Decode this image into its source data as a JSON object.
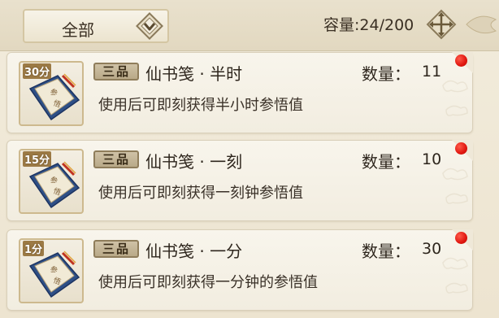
{
  "header": {
    "filter_label": "全部",
    "capacity_label": "容量:",
    "capacity_value": "24/200"
  },
  "items": [
    {
      "thumb_tag": "30分",
      "rank": "三品",
      "name": "仙书笺 · 半时",
      "qty_label": "数量：",
      "qty": "11",
      "desc": "使用后可即刻获得半小时参悟值"
    },
    {
      "thumb_tag": "15分",
      "rank": "三品",
      "name": "仙书笺 · 一刻",
      "qty_label": "数量：",
      "qty": "10",
      "desc": "使用后可即刻获得一刻钟参悟值"
    },
    {
      "thumb_tag": "1分",
      "rank": "三品",
      "name": "仙书笺 · 一分",
      "qty_label": "数量：",
      "qty": "30",
      "desc": "使用后可即刻获得一分钟的参悟值"
    }
  ],
  "colors": {
    "notification_dot": "#e0160f",
    "card_bg": "#f8f5ec",
    "rank_badge": "#c4b595"
  },
  "icons": {
    "filter_arrow": "chevron-down-icon",
    "expand": "expand-arrows-icon",
    "item": "scroll-book-icon"
  }
}
